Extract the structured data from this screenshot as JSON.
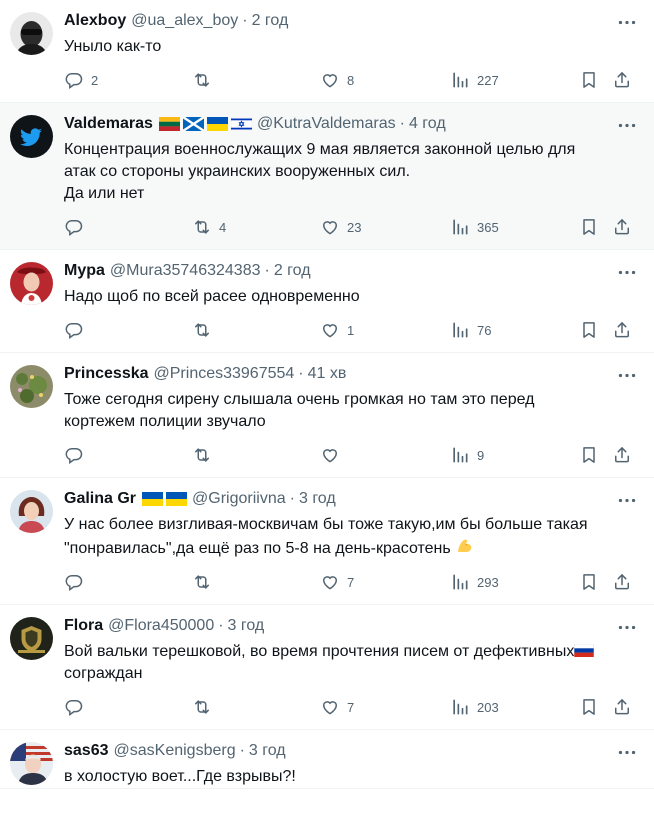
{
  "tweets": [
    {
      "name": "Alexboy",
      "handle": "@ua_alex_boy",
      "time": "2 год",
      "avatar": "dark-glasses-avatar",
      "lines": [
        "Уныло как-то"
      ],
      "stats": {
        "replies": "2",
        "retweets": "",
        "likes": "8",
        "views": "227"
      },
      "highlight": false
    },
    {
      "name": "Valdemaras",
      "handle": "@KutraValdemaras",
      "time": "4 год",
      "avatar": "bird-avatar",
      "flags": [
        "flag-lithuania",
        "flag-scotland",
        "flag-ukraine",
        "flag-israel"
      ],
      "lines": [
        "Концентрация военнослужащих 9 мая является законной целью для",
        "атак со стороны украинских вооруженных сил.",
        "Да или нет"
      ],
      "stats": {
        "replies": "",
        "retweets": "4",
        "likes": "23",
        "views": "365"
      },
      "highlight": true
    },
    {
      "name": "Mypa",
      "handle": "@Mura35746324383",
      "time": "2 год",
      "avatar": "woman-red-avatar",
      "lines": [
        "Надо щоб по всей расее одновременно"
      ],
      "stats": {
        "replies": "",
        "retweets": "",
        "likes": "1",
        "views": "76"
      },
      "highlight": false
    },
    {
      "name": "Princesska",
      "handle": "@Princes33967554",
      "time": "41 хв",
      "avatar": "flowers-avatar",
      "lines": [
        "Тоже сегодня сирену слышала очень громкая но там это перед",
        "кортежем полиции звучало"
      ],
      "stats": {
        "replies": "",
        "retweets": "",
        "likes": "",
        "views": "9"
      },
      "highlight": false
    },
    {
      "name": "Galina Gr",
      "handle": "@Grigoriivna",
      "time": "3 год",
      "avatar": "woman-portrait-avatar",
      "flags": [
        "flag-ukraine",
        "flag-ukraine"
      ],
      "lines": [
        "У нас более визгливая-москвичам бы тоже такую,им бы больше такая",
        "\"понравилась\",да ещё раз по 5-8 на день-красотень"
      ],
      "trailing_emoji": "flexed-biceps-emoji",
      "stats": {
        "replies": "",
        "retweets": "",
        "likes": "7",
        "views": "293"
      },
      "highlight": false
    },
    {
      "name": "Flora",
      "handle": "@Flora450000",
      "time": "3 год",
      "avatar": "emblem-avatar",
      "lines": [
        "Вой вальки терешковой, во время прочтения писем от дефективных",
        "сограждан"
      ],
      "line1_trailing_flag": "flag-russia",
      "stats": {
        "replies": "",
        "retweets": "",
        "likes": "7",
        "views": "203"
      },
      "highlight": false
    },
    {
      "name": "sas63",
      "handle": "@sasKenigsberg",
      "time": "3 год",
      "avatar": "man-flag-avatar",
      "lines": [
        "в холостую воет...Где взрывы?!"
      ],
      "highlight": false
    }
  ],
  "separator": "·",
  "icons": {
    "reply": "reply-icon",
    "retweet": "retweet-icon",
    "like": "heart-icon",
    "views": "views-chart-icon",
    "bookmark": "bookmark-icon",
    "share": "share-icon",
    "more": "more-icon"
  },
  "colors": {
    "text": "#0f1419",
    "muted": "#536471",
    "divider": "#eff3f4",
    "highlight_bg": "#f7f9f9"
  }
}
